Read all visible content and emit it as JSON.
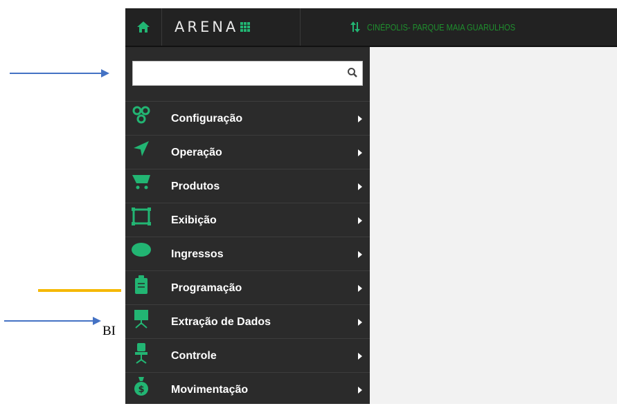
{
  "topbar": {
    "logo_text": "ARENA",
    "cinema_name": "CINÉPOLIS- PARQUE MAIA GUARULHOS"
  },
  "search": {
    "placeholder": "",
    "value": ""
  },
  "menu": [
    {
      "label": "Configuração",
      "icon": "gears-icon"
    },
    {
      "label": "Operação",
      "icon": "send-icon"
    },
    {
      "label": "Produtos",
      "icon": "cart-icon"
    },
    {
      "label": "Exibição",
      "icon": "frame-icon"
    },
    {
      "label": "Ingressos",
      "icon": "ticket-icon"
    },
    {
      "label": "Programação",
      "icon": "clipboard-icon"
    },
    {
      "label": "Extração de Dados",
      "icon": "presentation-icon"
    },
    {
      "label": "Controle",
      "icon": "chair-icon"
    },
    {
      "label": "Movimentação",
      "icon": "money-bag-icon"
    }
  ],
  "annotation": {
    "text": "BI"
  },
  "colors": {
    "accent": "#22b573",
    "cinema_text": "#1f8f2e",
    "sidebar_bg": "#2b2b2b",
    "topbar_bg": "#222222",
    "arrow_blue": "#4472c4",
    "line_yellow": "#f5b800"
  }
}
